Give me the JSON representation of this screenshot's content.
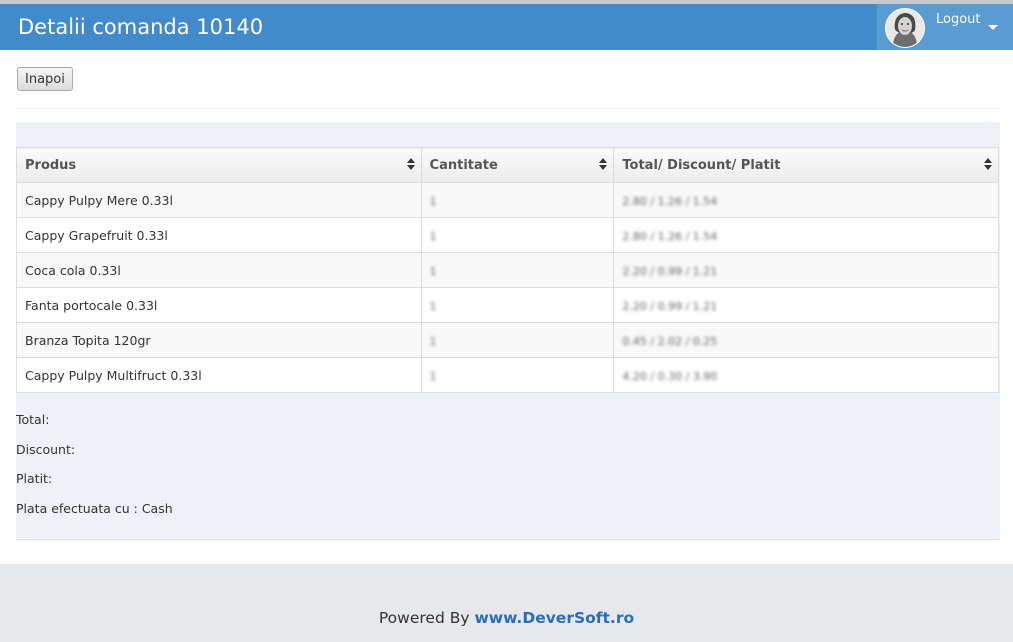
{
  "header": {
    "title": "Detalii comanda 10140",
    "user_menu": {
      "label": "Logout",
      "avatar_icon": "user-avatar-icon",
      "caret_icon": "caret-down-icon"
    }
  },
  "toolbar": {
    "back_label": "Inapoi"
  },
  "table": {
    "columns": [
      "Produs",
      "Cantitate",
      "Total/ Discount/ Platit"
    ],
    "rows": [
      {
        "product": "Cappy Pulpy Mere 0.33l",
        "quantity": "1",
        "amounts": "2.80 / 1.26 / 1.54"
      },
      {
        "product": "Cappy Grapefruit 0.33l",
        "quantity": "1",
        "amounts": "2.80 / 1.26 / 1.54"
      },
      {
        "product": "Coca cola 0.33l",
        "quantity": "1",
        "amounts": "2.20 / 0.99 / 1.21"
      },
      {
        "product": "Fanta portocale 0.33l",
        "quantity": "1",
        "amounts": "2.20 / 0.99 / 1.21"
      },
      {
        "product": "Branza Topita 120gr",
        "quantity": "1",
        "amounts": "0.45 / 2.02 / 0.25"
      },
      {
        "product": "Cappy Pulpy Multifruct 0.33l",
        "quantity": "1",
        "amounts": "4.20 / 0.30 / 3.90"
      }
    ]
  },
  "summary": {
    "total_label": "Total:",
    "total_value": "",
    "discount_label": "Discount:",
    "discount_value": "",
    "paid_label": "Platit:",
    "paid_value": "",
    "payment_label": "Plata efectuata cu : Cash"
  },
  "footer": {
    "powered_by": "Powered By",
    "link": "www.DeverSoft.ro"
  },
  "colors": {
    "header": "#428bca",
    "user_menu": "#5a9bd2",
    "panel": "#eef2f7",
    "footer": "#e6e8eb",
    "link": "#2a6ebb"
  }
}
